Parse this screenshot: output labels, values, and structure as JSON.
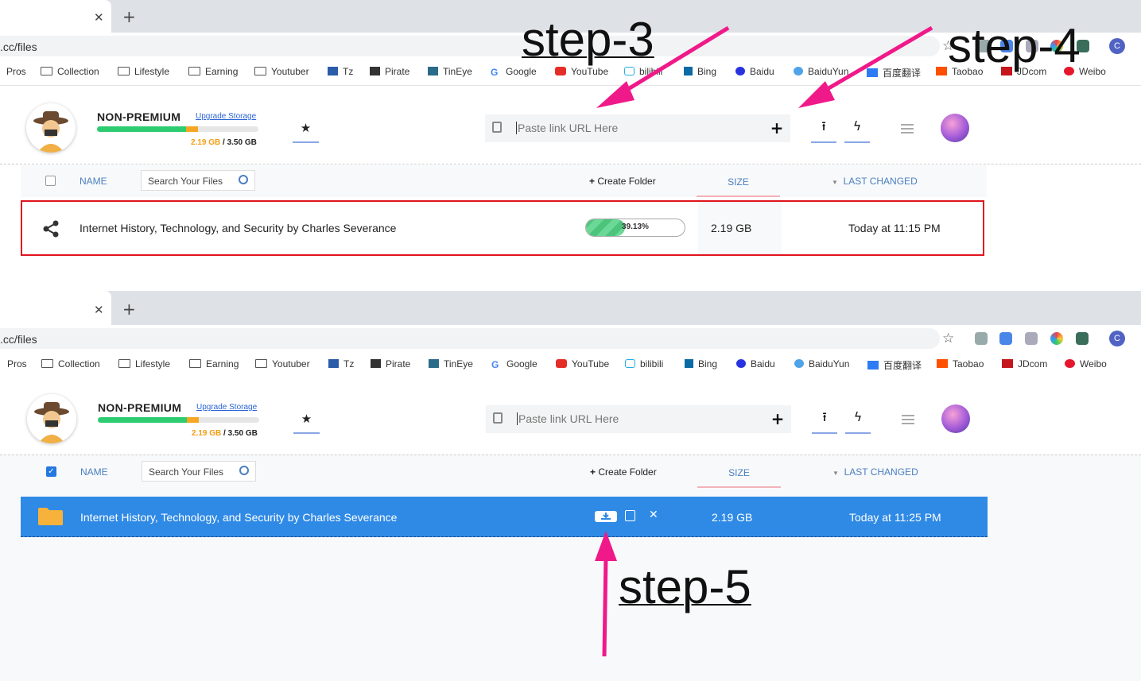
{
  "browser": {
    "url_text": ".cc/files",
    "profile_initial": "C",
    "bookmarks": [
      "Pros",
      "Collection",
      "Lifestyle",
      "Earning",
      "Youtuber",
      "Tz",
      "Pirate",
      "TinEye",
      "Google",
      "YouTube",
      "bilibili",
      "Bing",
      "Baidu",
      "BaiduYun",
      "百度翻译",
      "Taobao",
      "JDcom",
      "Weibo"
    ]
  },
  "app": {
    "plan": "NON-PREMIUM",
    "upgrade": "Upgrade Storage",
    "used": "2.19 GB",
    "total": "/ 3.50 GB",
    "storage_used_fraction": 0.626,
    "paste_placeholder": "Paste link URL Here",
    "header": {
      "name": "NAME",
      "search": "Search Your Files",
      "create_folder": "Create Folder",
      "size": "SIZE",
      "last_changed": "LAST CHANGED"
    }
  },
  "row1": {
    "name": "Internet History, Technology, and Security by Charles Severance",
    "progress": "39.13%",
    "progress_value": 39.13,
    "size": "2.19 GB",
    "changed": "Today at 11:15 PM"
  },
  "row2": {
    "name": "Internet History, Technology, and Security by Charles Severance",
    "size": "2.19 GB",
    "changed": "Today at 11:25 PM"
  },
  "annotations": {
    "s3": "step-3",
    "s4": "step-4",
    "s5": "step-5"
  },
  "colors": {
    "arrow": "#f0198a",
    "selected_row": "#2f8ae6",
    "highlight_border": "#e0141e"
  }
}
